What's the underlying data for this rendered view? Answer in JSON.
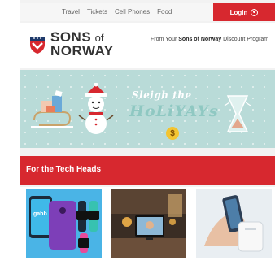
{
  "topnav": {
    "links": [
      "Travel",
      "Tickets",
      "Cell Phones",
      "Food"
    ],
    "login_label": "Login"
  },
  "header": {
    "logo_line1": "SONS",
    "logo_of": "of",
    "logo_line2": "NORWAY",
    "promo_prefix": "From Your ",
    "promo_bold": "Sons of Norway",
    "promo_suffix": " Discount Program"
  },
  "banner": {
    "line1": "Sleigh the",
    "line2": "HoLiYAYs",
    "coin": "$"
  },
  "section": {
    "title": "For the Tech Heads"
  },
  "colors": {
    "brand_red": "#d7282f",
    "banner_bg": "#b9dbd8"
  }
}
